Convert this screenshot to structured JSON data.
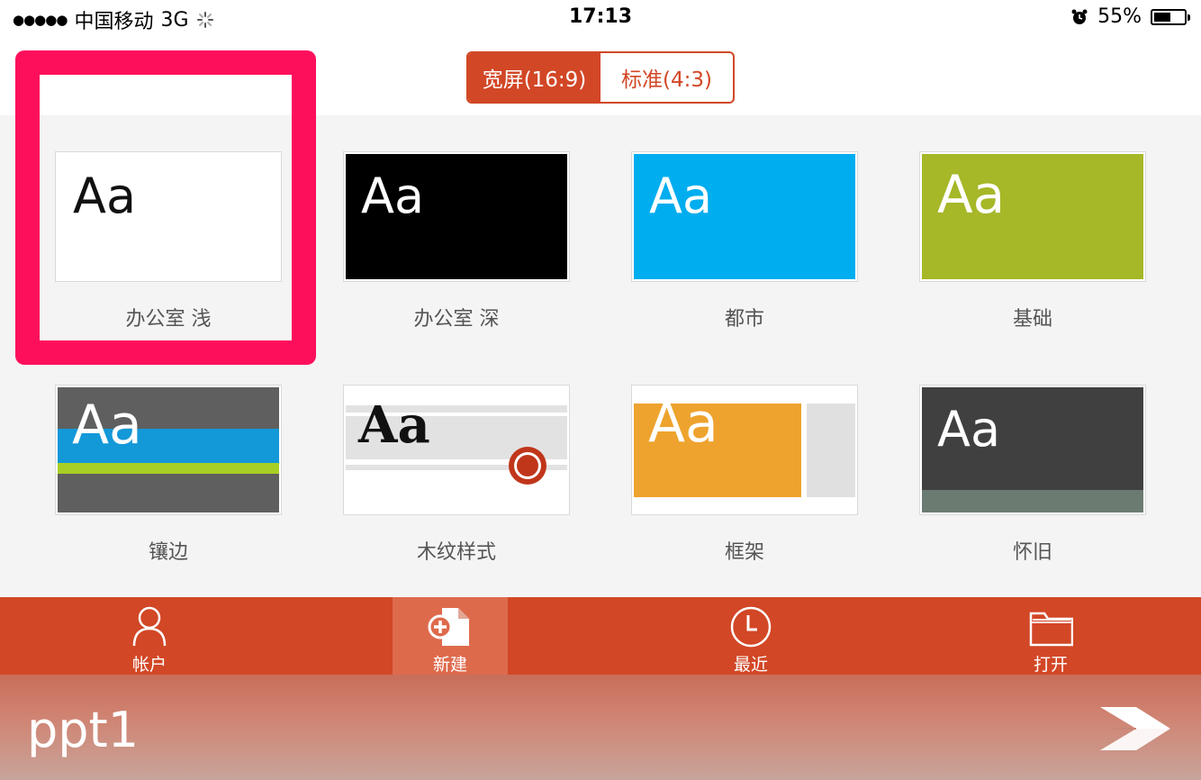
{
  "status_bar": {
    "signal": "●●●●●",
    "carrier": "中国移动",
    "network": "3G",
    "time": "17:13",
    "battery_percent": "55%",
    "battery_level": 0.55
  },
  "aspect_toggle": {
    "widescreen_label": "宽屏(16:9)",
    "standard_label": "标准(4:3)",
    "selected": "widescreen"
  },
  "templates": [
    {
      "id": "office-light",
      "name": "办公室 浅",
      "sample": "Aa",
      "selected": true
    },
    {
      "id": "office-dark",
      "name": "办公室 深",
      "sample": "Aa",
      "selected": false
    },
    {
      "id": "metropolitan",
      "name": "都市",
      "sample": "Aa",
      "selected": false
    },
    {
      "id": "basis",
      "name": "基础",
      "sample": "Aa",
      "selected": false
    },
    {
      "id": "inset",
      "name": "镶边",
      "sample": "Aa",
      "selected": false
    },
    {
      "id": "wood-type",
      "name": "木纹样式",
      "sample": "Aa",
      "selected": false
    },
    {
      "id": "frame",
      "name": "框架",
      "sample": "Aa",
      "selected": false
    },
    {
      "id": "retrospect",
      "name": "怀旧",
      "sample": "Aa",
      "selected": false
    }
  ],
  "tabs": [
    {
      "id": "account",
      "label": "帐户",
      "icon": "person-icon",
      "active": false
    },
    {
      "id": "new",
      "label": "新建",
      "icon": "new-document-icon",
      "active": true
    },
    {
      "id": "recent",
      "label": "最近",
      "icon": "clock-icon",
      "active": false
    },
    {
      "id": "open",
      "label": "打开",
      "icon": "folder-icon",
      "active": false
    }
  ],
  "banner": {
    "title": "ppt1",
    "logo_icon": "arrow-logo-icon"
  },
  "colors": {
    "accent": "#d24726",
    "highlight": "#fe0f5c"
  }
}
